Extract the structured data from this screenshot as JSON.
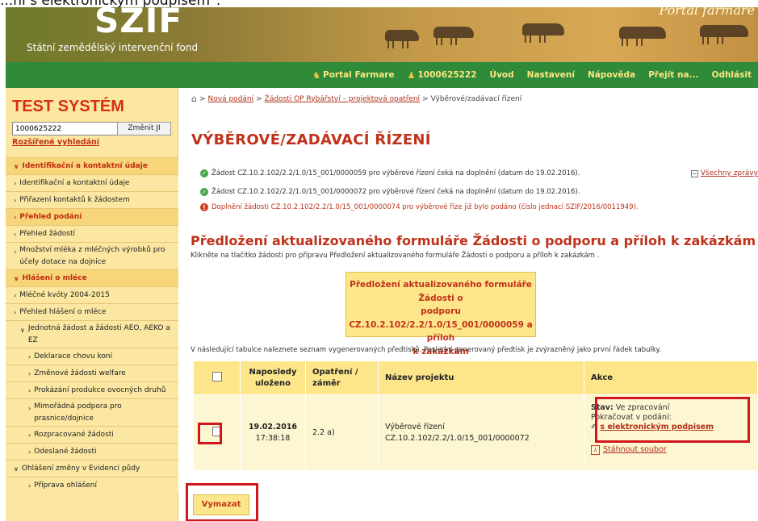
{
  "caption": "...ní s elektronickým podpisem\".",
  "banner": {
    "logo": "SZIF",
    "org": "Státní zemědělský intervenční fond",
    "portal_title": "Portál farmáře"
  },
  "nav": {
    "items": [
      {
        "label": "Portal Farmare",
        "icon": "farmer-icon"
      },
      {
        "label": "1000625222",
        "icon": "user-icon"
      },
      {
        "label": "Úvod"
      },
      {
        "label": "Nastavení"
      },
      {
        "label": "Nápověda"
      },
      {
        "label": "Přejít na..."
      },
      {
        "label": "Odhlásit"
      }
    ]
  },
  "sidebar": {
    "title": "TEST SYSTÉM",
    "search_value": "1000625222",
    "change_label": "Změnit JI",
    "advanced_link": "Rozšířené vyhledání",
    "menu": [
      {
        "label": "Identifikační a kontaktní údaje",
        "type": "head"
      },
      {
        "label": "Identifikační a kontaktní údaje",
        "type": "l1"
      },
      {
        "label": "Přiřazení kontaktů k žádostem",
        "type": "l1"
      },
      {
        "label": "Přehled podání",
        "type": "head"
      },
      {
        "label": "Přehled žádostí",
        "type": "l1"
      },
      {
        "label": "Množství mléka z mléčných výrobků pro účely dotace na dojnice",
        "type": "l1"
      },
      {
        "label": "Hlášení o mléce",
        "type": "head"
      },
      {
        "label": "Mléčné kvóty 2004-2015",
        "type": "l1"
      },
      {
        "label": "Přehled hlášení o mléce",
        "type": "l1"
      },
      {
        "label": "Jednotná žádost a žádosti AEO, AEKO a EZ",
        "type": "l2"
      },
      {
        "label": "Deklarace chovu koní",
        "type": "l2b"
      },
      {
        "label": "Změnové žádosti welfare",
        "type": "l2b"
      },
      {
        "label": "Prokázání produkce ovocných druhů",
        "type": "l2b"
      },
      {
        "label": "Mimořádná podpora pro prasnice/dojnice",
        "type": "l2b"
      },
      {
        "label": "Rozpracované žádosti",
        "type": "l2b"
      },
      {
        "label": "Odeslané žádosti",
        "type": "l2b"
      },
      {
        "label": "Ohlášení změny v Evidenci půdy",
        "type": "l1"
      },
      {
        "label": "Příprava ohlášení",
        "type": "l2b"
      }
    ]
  },
  "breadcrumb": {
    "items": [
      "Nová podání",
      "Žádosti OP Rybářství – projektová opatření"
    ],
    "current": "Výběrové/zadávací řízení"
  },
  "page_title": "VÝBĚROVÉ/ZADÁVACÍ ŘÍZENÍ",
  "messages": [
    {
      "type": "ok",
      "text": "Žádost CZ.10.2.102/2.2/1.0/15_001/0000059 pro výběrové řízení čeká na doplnění (datum do 19.02.2016)."
    },
    {
      "type": "ok",
      "text": "Žádost CZ.10.2.102/2.2/1.0/15_001/0000072 pro výběrové řízení čeká na doplnění (datum do 19.02.2016)."
    },
    {
      "type": "error",
      "text": "Doplnění žádosti CZ.10.2.102/2.2/1.0/15_001/0000074 pro výběrové říze již bylo podáno (číslo jednací SZIF/2016/0011949)."
    }
  ],
  "all_messages_label": "Všechny zprávy",
  "section_title": "Předložení aktualizovaného formuláře Žádosti o podporu a příloh k zakázkám",
  "instruction": "Klikněte na tlačítko žádosti pro přípravu Předložení aktualizovaného formuláře Žádosti o podporu a příloh k zakázkám .",
  "big_button": {
    "line1": "Předložení aktualizovaného formuláře Žádosti o",
    "line2": "podporu",
    "line3": "CZ.10.2.102/2.2/1.0/15_001/0000059 a příloh",
    "line4": "k zakázkám"
  },
  "table_note": "V následující tabulce naleznete seznam vygenerovaných předtisků. Poslední generovaný předtisk je zvýrazněný jako první řádek tabulky.",
  "table": {
    "headers": {
      "saved": "Naposledy uloženo",
      "measure": "Opatření / záměr",
      "project": "Název projektu",
      "action": "Akce"
    },
    "rows": [
      {
        "date": "19.02.2016",
        "time": "17:38:18",
        "measure": "2.2 a)",
        "project_name": "Výběrové řízení",
        "project_id": "CZ.10.2.102/2.2/1.0/15_001/0000072",
        "status_label": "Stav:",
        "status_value": "Ve zpracování",
        "continue_label": "Pokračovat v podání:",
        "sign_link": "s elektronickým podpisem",
        "download_link": "Stáhnout soubor"
      }
    ]
  },
  "delete_label": "Vymazat",
  "colors": {
    "accent_red": "#c0321a",
    "nav_green": "#2f8b3a",
    "sidebar_bg": "#fbe7a1",
    "highlight_box": "#d3151c"
  }
}
